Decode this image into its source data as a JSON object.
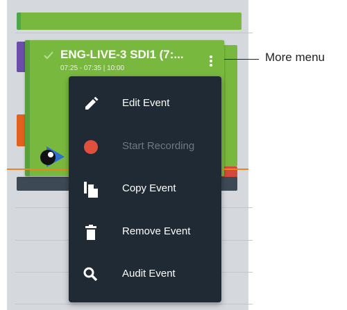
{
  "event": {
    "title": "ENG-LIVE-3 SDI1 (7:...",
    "time_range": "07:25 - 07:35  |  10:00"
  },
  "callout": {
    "label": "More menu"
  },
  "menu": {
    "items": [
      {
        "label": "Edit Event",
        "icon": "pencil-icon",
        "enabled": true
      },
      {
        "label": "Start Recording",
        "icon": "record-dot-icon",
        "enabled": false
      },
      {
        "label": "Copy Event",
        "icon": "copy-icon",
        "enabled": true
      },
      {
        "label": "Remove Event",
        "icon": "trash-icon",
        "enabled": true
      },
      {
        "label": "Audit Event",
        "icon": "search-icon",
        "enabled": true
      }
    ]
  },
  "colors": {
    "event_green": "#79b83e",
    "menu_background": "#1f2a34",
    "record_red": "#e0503c",
    "current_time_line": "#f0831e"
  }
}
